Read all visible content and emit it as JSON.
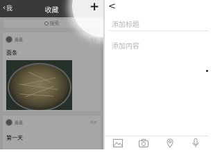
{
  "left_panel": {
    "header": {
      "back_label": "我",
      "title": "收藏",
      "add_symbol": "+"
    },
    "search": {
      "placeholder": "搜索"
    },
    "cards": [
      {
        "user": "晨晨",
        "time": "今天",
        "text": "面条"
      },
      {
        "user": "晨晨",
        "time": "今天",
        "text": "第一天"
      }
    ]
  },
  "right_panel": {
    "back_symbol": "<",
    "title_placeholder": "添加标题",
    "content_placeholder": "添加内容",
    "toolbar": [
      "image-icon",
      "camera-icon",
      "location-icon",
      "microphone-icon"
    ]
  },
  "colors": {
    "header_bg": "#3a3a3a",
    "panel_bg": "#f2f2f2",
    "placeholder": "#b5b5b5",
    "icon": "#9a9a9a"
  }
}
